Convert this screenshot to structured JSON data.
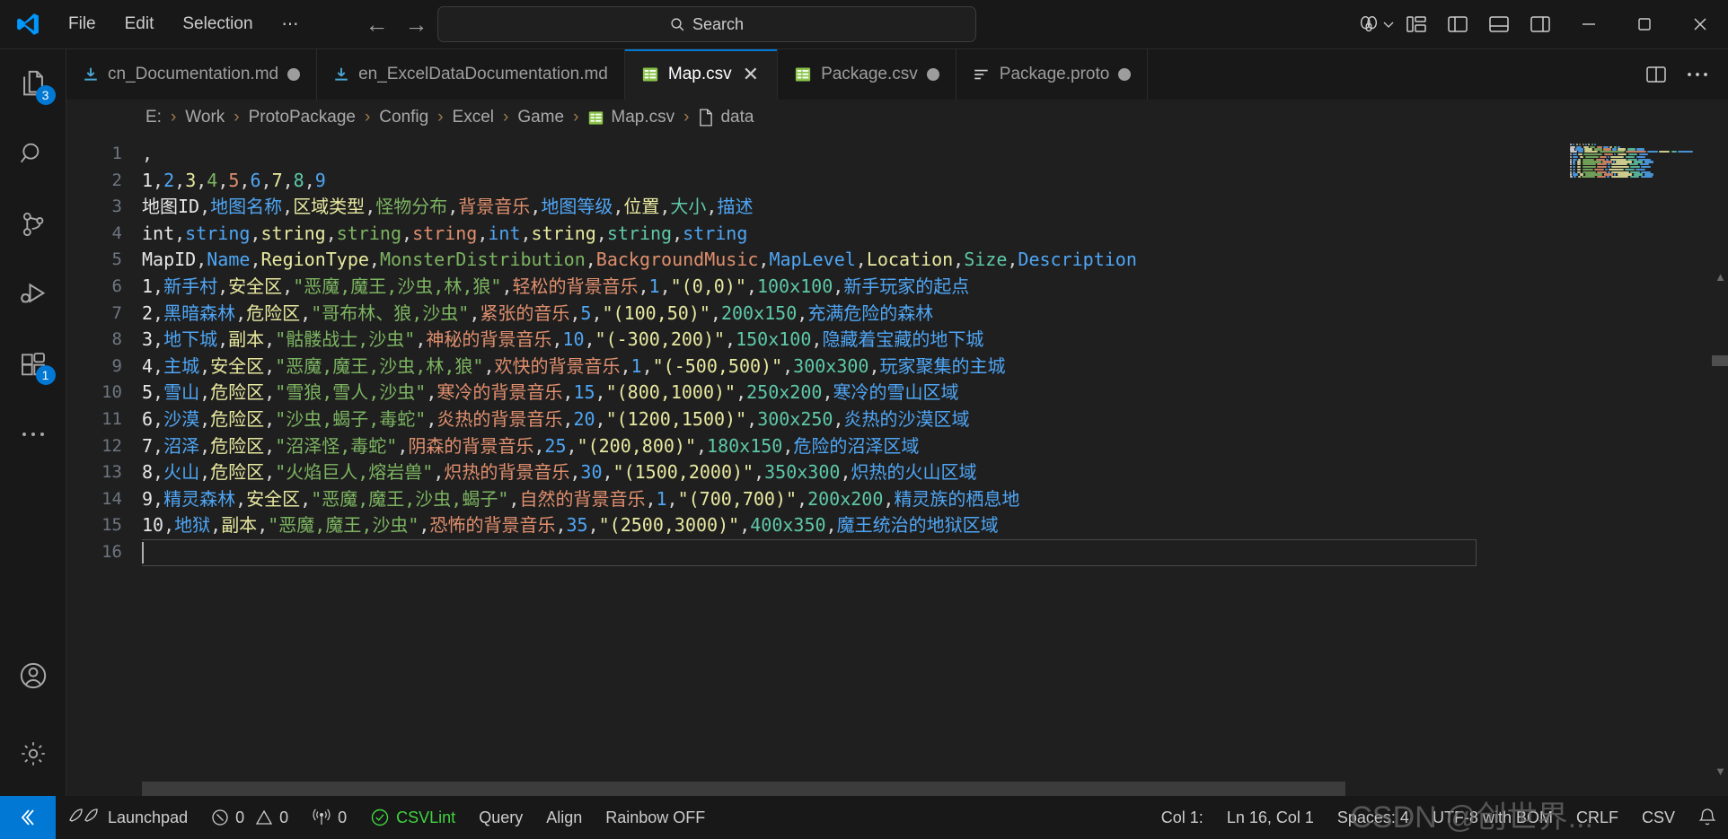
{
  "titlebar": {
    "logo_icon": "vscode-logo-icon",
    "menus": [
      {
        "label": "File",
        "name": "menu-file"
      },
      {
        "label": "Edit",
        "name": "menu-edit"
      },
      {
        "label": "Selection",
        "name": "menu-selection"
      },
      {
        "label": "⋯",
        "name": "menu-more"
      }
    ],
    "nav": {
      "back_icon": "arrow-left-icon",
      "forward_icon": "arrow-right-icon",
      "back": "←",
      "forward": "→"
    },
    "search": {
      "placeholder": "Search",
      "value": "Search",
      "icon": "search-icon"
    },
    "right_icons": [
      {
        "name": "accounts-copilot-icon",
        "glyph": "copilot"
      },
      {
        "name": "customize-layout-icon",
        "glyph": "layout"
      },
      {
        "name": "toggle-primary-sidebar-icon",
        "glyph": "panel-left"
      },
      {
        "name": "toggle-panel-icon",
        "glyph": "panel-bottom"
      },
      {
        "name": "toggle-secondary-sidebar-icon",
        "glyph": "panel-right"
      }
    ],
    "window_controls": [
      {
        "name": "minimize-button",
        "glyph": "–"
      },
      {
        "name": "maximize-button",
        "glyph": "☐"
      },
      {
        "name": "close-button",
        "glyph": "✕"
      }
    ]
  },
  "activitybar": {
    "items": [
      {
        "name": "sidebar-item-explorer",
        "icon": "files-icon",
        "badge": "3",
        "active": false
      },
      {
        "name": "sidebar-item-search",
        "icon": "search-icon",
        "badge": "",
        "active": false
      },
      {
        "name": "sidebar-item-source-control",
        "icon": "source-control-icon",
        "badge": "",
        "active": false
      },
      {
        "name": "sidebar-item-run-debug",
        "icon": "run-and-debug-icon",
        "badge": "",
        "active": false
      },
      {
        "name": "sidebar-item-extensions",
        "icon": "extensions-icon",
        "badge": "1",
        "active": false
      },
      {
        "name": "sidebar-item-more",
        "icon": "ellipsis-icon",
        "badge": "",
        "active": false
      }
    ],
    "bottom": [
      {
        "name": "accounts-button",
        "icon": "account-icon"
      },
      {
        "name": "settings-button",
        "icon": "gear-icon"
      }
    ]
  },
  "tabs": [
    {
      "label": "cn_Documentation.md",
      "icon": "markdown-icon",
      "dirty": true,
      "active": false,
      "name": "tab-cn-documentation"
    },
    {
      "label": "en_ExcelDataDocumentation.md",
      "icon": "markdown-icon",
      "dirty": false,
      "active": false,
      "name": "tab-en-excel-data-documentation"
    },
    {
      "label": "Map.csv",
      "icon": "csv-icon",
      "dirty": false,
      "active": true,
      "close": "✕",
      "name": "tab-map-csv"
    },
    {
      "label": "Package.csv",
      "icon": "csv-icon",
      "dirty": true,
      "active": false,
      "name": "tab-package-csv"
    },
    {
      "label": "Package.proto",
      "icon": "proto-icon",
      "dirty": true,
      "active": false,
      "name": "tab-package-proto"
    }
  ],
  "tabs_actions": [
    {
      "name": "split-editor-right-button",
      "glyph": "split"
    },
    {
      "name": "editor-more-actions-button",
      "glyph": "⋯"
    }
  ],
  "breadcrumbs": [
    {
      "label": "E:",
      "name": "breadcrumb-drive"
    },
    {
      "label": "Work",
      "name": "breadcrumb-work"
    },
    {
      "label": "ProtoPackage",
      "name": "breadcrumb-protopackage"
    },
    {
      "label": "Config",
      "name": "breadcrumb-config"
    },
    {
      "label": "Excel",
      "name": "breadcrumb-excel"
    },
    {
      "label": "Game",
      "name": "breadcrumb-game"
    },
    {
      "label": "Map.csv",
      "icon": "csv-icon",
      "name": "breadcrumb-map-csv"
    },
    {
      "label": "data",
      "icon": "file-icon",
      "name": "breadcrumb-data"
    }
  ],
  "breadcrumb_separator": "›",
  "editor": {
    "line_numbers": [
      "1",
      "2",
      "3",
      "4",
      "5",
      "6",
      "7",
      "8",
      "9",
      "10",
      "11",
      "12",
      "13",
      "14",
      "15",
      "16"
    ],
    "lines": [
      {
        "n": 1,
        "cells": [
          ""
        ],
        "raw": ","
      },
      {
        "n": 2,
        "cells": [
          "1",
          "2",
          "3",
          "4",
          "5",
          "6",
          "7",
          "8",
          "9"
        ]
      },
      {
        "n": 3,
        "cells": [
          "地图ID",
          "地图名称",
          "区域类型",
          "怪物分布",
          "背景音乐",
          "地图等级",
          "位置",
          "大小",
          "描述"
        ]
      },
      {
        "n": 4,
        "cells": [
          "int",
          "string",
          "string",
          "string",
          "string",
          "int",
          "string",
          "string",
          "string"
        ]
      },
      {
        "n": 5,
        "cells": [
          "MapID",
          "Name",
          "RegionType",
          "MonsterDistribution",
          "BackgroundMusic",
          "MapLevel",
          "Location",
          "Size",
          "Description"
        ]
      },
      {
        "n": 6,
        "cells": [
          "1",
          "新手村",
          "安全区",
          "\"恶魔,魔王,沙虫,林,狼\"",
          "轻松的背景音乐",
          "1",
          "\"(0,0)\"",
          "100x100",
          "新手玩家的起点"
        ]
      },
      {
        "n": 7,
        "cells": [
          "2",
          "黑暗森林",
          "危险区",
          "\"哥布林、狼,沙虫\"",
          "紧张的音乐",
          "5",
          "\"(100,50)\"",
          "200x150",
          "充满危险的森林"
        ]
      },
      {
        "n": 8,
        "cells": [
          "3",
          "地下城",
          "副本",
          "\"骷髅战士,沙虫\"",
          "神秘的背景音乐",
          "10",
          "\"(-300,200)\"",
          "150x100",
          "隐藏着宝藏的地下城"
        ]
      },
      {
        "n": 9,
        "cells": [
          "4",
          "主城",
          "安全区",
          "\"恶魔,魔王,沙虫,林,狼\"",
          "欢快的背景音乐",
          "1",
          "\"(-500,500)\"",
          "300x300",
          "玩家聚集的主城"
        ]
      },
      {
        "n": 10,
        "cells": [
          "5",
          "雪山",
          "危险区",
          "\"雪狼,雪人,沙虫\"",
          "寒冷的背景音乐",
          "15",
          "\"(800,1000)\"",
          "250x200",
          "寒冷的雪山区域"
        ]
      },
      {
        "n": 11,
        "cells": [
          "6",
          "沙漠",
          "危险区",
          "\"沙虫,蝎子,毒蛇\"",
          "炎热的背景音乐",
          "20",
          "\"(1200,1500)\"",
          "300x250",
          "炎热的沙漠区域"
        ]
      },
      {
        "n": 12,
        "cells": [
          "7",
          "沼泽",
          "危险区",
          "\"沼泽怪,毒蛇\"",
          "阴森的背景音乐",
          "25",
          "\"(200,800)\"",
          "180x150",
          "危险的沼泽区域"
        ]
      },
      {
        "n": 13,
        "cells": [
          "8",
          "火山",
          "危险区",
          "\"火焰巨人,熔岩兽\"",
          "炽热的背景音乐",
          "30",
          "\"(1500,2000)\"",
          "350x300",
          "炽热的火山区域"
        ]
      },
      {
        "n": 14,
        "cells": [
          "9",
          "精灵森林",
          "安全区",
          "\"恶魔,魔王,沙虫,蝎子\"",
          "自然的背景音乐",
          "1",
          "\"(700,700)\"",
          "200x200",
          "精灵族的栖息地"
        ]
      },
      {
        "n": 15,
        "cells": [
          "10",
          "地狱",
          "副本",
          "\"恶魔,魔王,沙虫\"",
          "恐怖的背景音乐",
          "35",
          "\"(2500,3000)\"",
          "400x350",
          "魔王统治的地狱区域"
        ]
      },
      {
        "n": 16,
        "cells": [
          ""
        ]
      }
    ],
    "column_colors": [
      "#e6e6e6",
      "#4fa6f5",
      "#e8e9a0",
      "#7cb461",
      "#e08f6e",
      "#4fa6f5",
      "#e8e9a0",
      "#5ec9a8",
      "#4fa6f5"
    ],
    "comma_color": "#d4d4d4",
    "background": "#1f1f1f"
  },
  "statusbar": {
    "remote_icon": "remote-window-icon",
    "left": [
      {
        "name": "status-launchpad",
        "label": "Launchpad",
        "icon": "rocket-icon"
      },
      {
        "name": "status-problems",
        "label": "0  ⚠ 0",
        "icon": "error-icon",
        "errors": "0",
        "warnings": "0"
      },
      {
        "name": "status-ports",
        "label": "0",
        "icon": "radio-tower-icon"
      },
      {
        "name": "status-csvlint",
        "label": "CSVLint",
        "icon": "check-circle-icon",
        "color": "#3fd43f"
      },
      {
        "name": "status-query",
        "label": "Query"
      },
      {
        "name": "status-align",
        "label": "Align"
      },
      {
        "name": "status-rainbow",
        "label": "Rainbow OFF"
      }
    ],
    "right": [
      {
        "name": "status-column",
        "label": "Col 1:"
      },
      {
        "name": "status-cursor-position",
        "label": "Ln 16, Col 1"
      },
      {
        "name": "status-indentation",
        "label": "Spaces: 4"
      },
      {
        "name": "status-encoding",
        "label": "UTF-8 with BOM"
      },
      {
        "name": "status-eol",
        "label": "CRLF"
      },
      {
        "name": "status-language-mode",
        "label": "CSV"
      },
      {
        "name": "status-notifications",
        "label": "",
        "icon": "bell-icon"
      }
    ],
    "watermark": "CSDN @创世界..."
  }
}
